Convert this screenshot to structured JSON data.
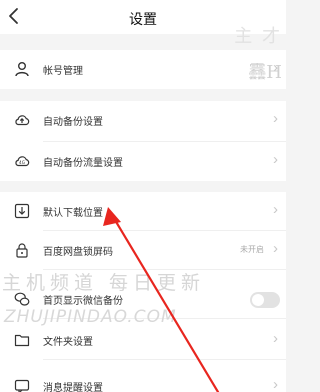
{
  "nav": {
    "back_icon": "chevron-left-icon",
    "title": "设置"
  },
  "groups": [
    {
      "rows": [
        {
          "key": "account",
          "icon": "user-icon",
          "label": "帐号管理"
        }
      ]
    },
    {
      "rows": [
        {
          "key": "auto-backup",
          "icon": "cloud-upload-icon",
          "label": "自动备份设置"
        },
        {
          "key": "auto-backup-traffic",
          "icon": "cloud-4g-icon",
          "label": "自动备份流量设置"
        }
      ]
    },
    {
      "rows": [
        {
          "key": "default-download",
          "icon": "download-icon",
          "label": "默认下载位置"
        },
        {
          "key": "lock-screen",
          "icon": "lock-icon",
          "label": "百度网盘锁屏码",
          "value": "未开启"
        },
        {
          "key": "wechat-backup",
          "icon": "wechat-icon",
          "label": "首页显示微信备份",
          "toggle": false
        },
        {
          "key": "folder-settings",
          "icon": "folder-icon",
          "label": "文件夹设置"
        },
        {
          "key": "notifications",
          "icon": "message-icon",
          "label": "消息提醒设置"
        }
      ]
    }
  ],
  "watermark": {
    "top_text": "主 才",
    "top_text_2": "䨺H",
    "middle_text": "主机频道 每日更新",
    "url_text": "ZHUJIPINDAO.COM"
  },
  "annotation": {
    "arrow_color": "#e8261f"
  }
}
